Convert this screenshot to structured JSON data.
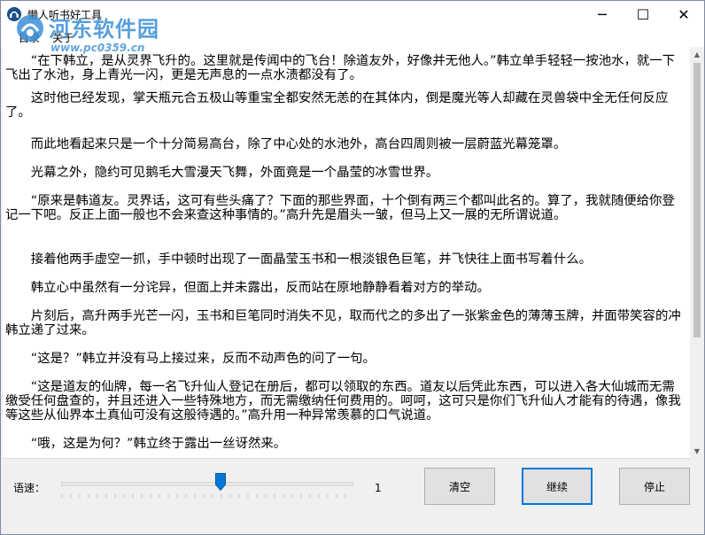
{
  "window": {
    "title": "懒人听书好工具",
    "controls": {
      "minimize": "─",
      "maximize": "☐",
      "close": "✕"
    }
  },
  "watermark": {
    "name": "河东软件园",
    "url": "www.pc0359.cn"
  },
  "menu": [
    "目录",
    "关于"
  ],
  "content": {
    "paragraphs": [
      "“在下韩立，是从灵界飞升的。这里就是传闻中的飞台！除道友外，好像并无他人。”韩立单手轻轻一按池水，就一下飞出了水池，身上青光一闪，更是无声息的一点水渍都没有了。",
      "这时他已经发现，掌天瓶元合五极山等重宝全都安然无恙的在其体内，倒是魔光等人却藏在灵兽袋中全无任何反应了。",
      "而此地看起来只是一个十分简易高台，除了中心处的水池外，高台四周则被一层蔚蓝光幕笼罩。",
      "光幕之外，隐约可见鹅毛大雪漫天飞舞，外面竟是一个晶莹的冰雪世界。",
      "“原来是韩道友。灵界话，这可有些头痛了？下面的那些界面，十个倒有两三个都叫此名的。算了，我就随便给你登记一下吧。反正上面一般也不会来查这种事情的。”高升先是眉头一皱，但马上又一展的无所谓说道。",
      "接着他两手虚空一抓，手中顿时出现了一面晶莹玉书和一根淡银色巨笔，并飞快往上面书写着什么。",
      "韩立心中虽然有一分诧异，但面上并未露出，反而站在原地静静看着对方的举动。",
      "片刻后，高升两手光芒一闪，玉书和巨笔同时消失不见，取而代之的多出了一张紫金色的薄薄玉牌，并面带笑容的冲韩立递了过来。",
      "“这是？”韩立并没有马上接过来，反而不动声色的问了一句。",
      "“这是道友的仙牌，每一名飞升仙人登记在册后，都可以领取的东西。道友以后凭此东西，可以进入各大仙城而无需缴受任何盘查的，并且还进入一些特殊地方，而无需缴纳任何费用的。呵呵，这可只是你们飞升仙人才能有的待遇，像我等这些从仙界本土真仙可没有这般待遇的。”高升用一种异常羡慕的口气说道。",
      "“哦，这是为何？”韩立终于露出一丝讶然来。"
    ]
  },
  "controls": {
    "speed_label": "语速：",
    "speed_value": "1",
    "speed_level_fraction": 0.55,
    "buttons": {
      "clear": "清空",
      "continue": "继续",
      "stop": "停止"
    }
  }
}
